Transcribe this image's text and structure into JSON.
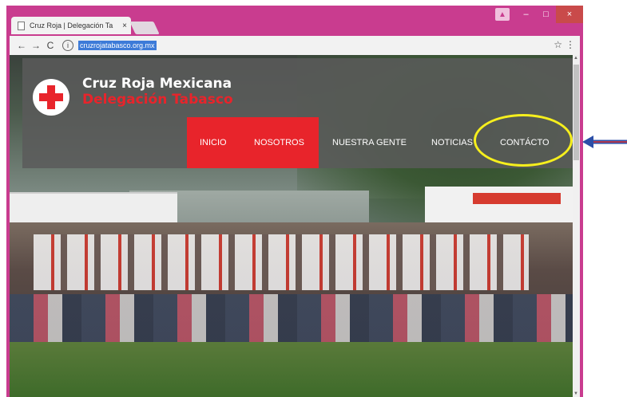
{
  "browser": {
    "tab_title": "Cruz Roja | Delegación Ta",
    "tab_close": "×",
    "url": "cruzrojatabasco.org.mx",
    "info_icon": "i",
    "back": "←",
    "forward": "→",
    "reload": "C",
    "star": "☆",
    "menu": "⋮",
    "minimize": "–",
    "maximize": "□",
    "close": "×",
    "user_icon": "▲"
  },
  "site": {
    "brand_line1": "Cruz Roja Mexicana",
    "brand_line2": "Delegación Tabasco",
    "nav": [
      "INICIO",
      "NOSOTROS",
      "NUESTRA GENTE",
      "NOTICIAS",
      "CONTÁCTO"
    ],
    "accent_color": "#e8242b"
  },
  "annotations": {
    "highlight_color": "#f6ef1d",
    "arrow_color": "#2c4fa8"
  }
}
